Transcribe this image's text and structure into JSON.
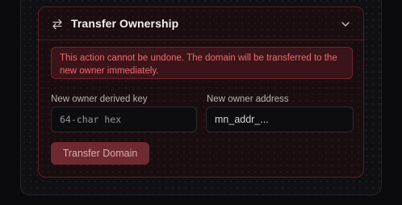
{
  "panel": {
    "title": "Transfer Ownership",
    "icons": {
      "header": "swap-arrows-icon",
      "toggle": "chevron-down-icon"
    }
  },
  "warning": {
    "text": "This action cannot be undone. The domain will be transferred to the new owner immediately."
  },
  "form": {
    "derived_key": {
      "label": "New owner derived key",
      "placeholder": "64-char hex",
      "value": ""
    },
    "address": {
      "label": "New owner address",
      "placeholder": "mn_addr_...",
      "value": ""
    }
  },
  "actions": {
    "transfer_label": "Transfer Domain"
  },
  "colors": {
    "danger_text": "#f06a74",
    "panel_border": "#5a1e22",
    "button_bg": "#6e2a30"
  }
}
